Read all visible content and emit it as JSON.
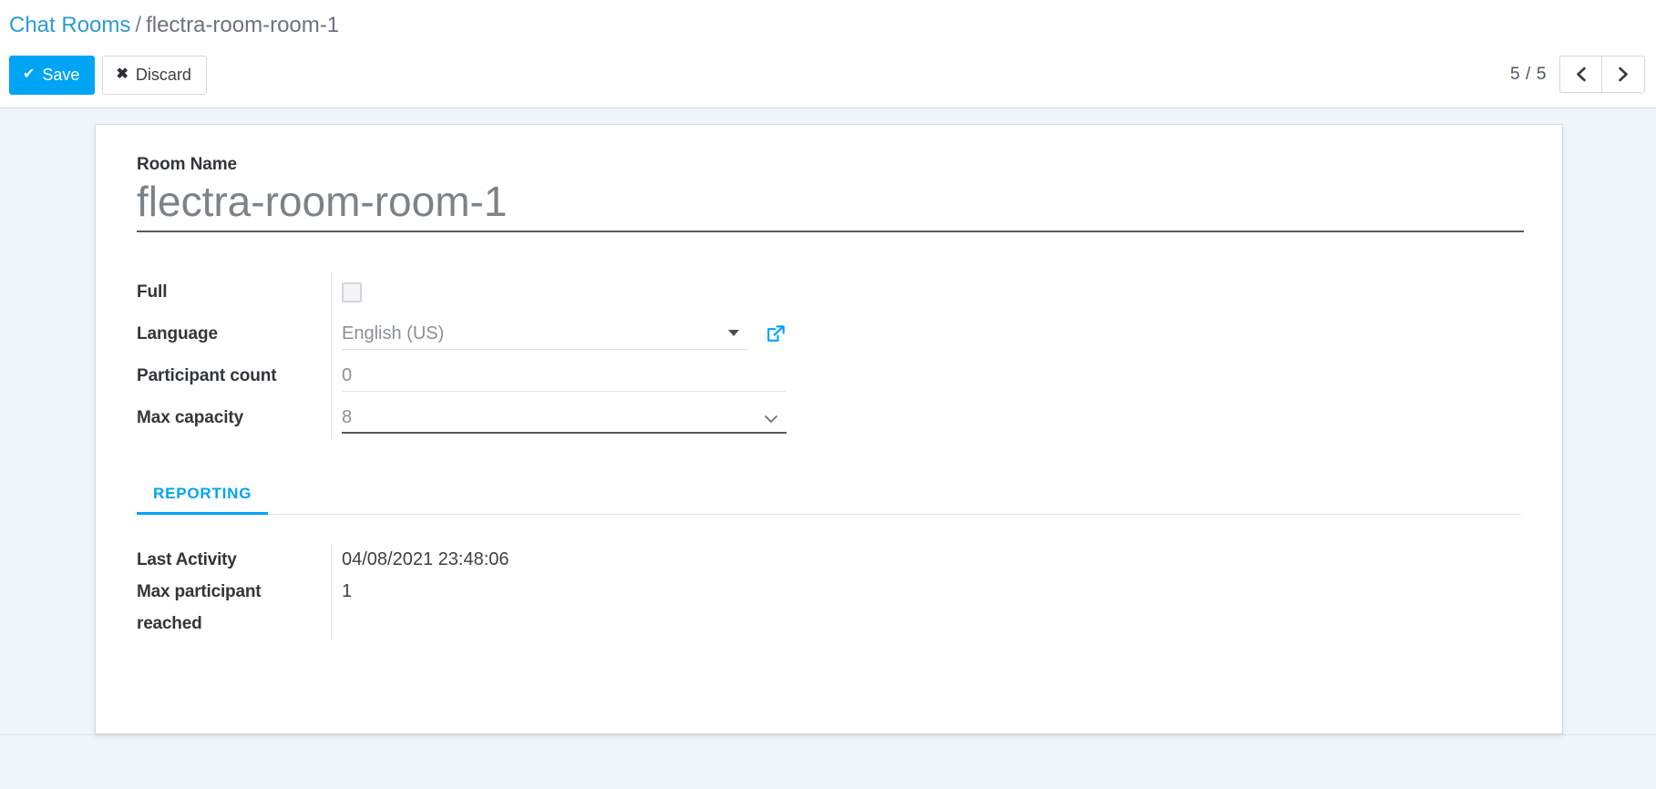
{
  "breadcrumb": {
    "root_label": "Chat Rooms",
    "separator": "/",
    "current_label": "flectra-room-room-1"
  },
  "toolbar": {
    "save_label": "Save",
    "save_icon": "check-icon",
    "discard_label": "Discard",
    "discard_icon": "times-icon",
    "save_color": "#00a4f5"
  },
  "pager": {
    "count_label": "5 / 5",
    "current": 5,
    "total": 5,
    "prev_icon": "chevron-left-icon",
    "next_icon": "chevron-right-icon"
  },
  "record": {
    "name_label": "Room Name",
    "name_value": "flectra-room-room-1"
  },
  "fields": [
    {
      "label": "Full",
      "widget": "checkbox",
      "value": "",
      "checked": false
    },
    {
      "label": "Language",
      "widget": "many2one",
      "value": "English (US)",
      "has_external_link": true,
      "external_link_icon": "external-link-icon",
      "caret": "caret-down-icon"
    },
    {
      "label": "Participant count",
      "widget": "integer",
      "value": "0"
    },
    {
      "label": "Max capacity",
      "widget": "select",
      "value": "8",
      "focused": true,
      "caret": "chevron-down-icon"
    }
  ],
  "notebook": {
    "tabs": [
      {
        "label": "Reporting",
        "active": true
      }
    ],
    "reporting": {
      "rows": [
        {
          "label": "Last Activity",
          "value": "04/08/2021 23:48:06"
        },
        {
          "label": "Max participant reached",
          "value": "1"
        }
      ]
    }
  },
  "theme": {
    "accent": "#00a4f5",
    "link": "#2c9bd6",
    "page_bg": "#f0f5f9",
    "sheet_bg": "#ffffff",
    "label_text": "#32363a",
    "value_text": "#7c8287"
  }
}
